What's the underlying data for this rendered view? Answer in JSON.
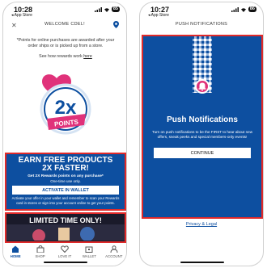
{
  "left_screen": {
    "status": {
      "time": "10:28",
      "back_app": "◂ App Store",
      "battery": "85"
    },
    "header": {
      "title": "WELCOME CDEL!"
    },
    "note": "*Points for online purchases are awarded after your order ships or is picked up from a store.",
    "rewards_link_prefix": "See how rewards work ",
    "rewards_link": "here",
    "points_text": "2x",
    "points_word": "POINTS",
    "promo": {
      "title_line1": "EARN FREE PRODUCTS",
      "title_line2": "2X FASTER!",
      "subtitle": "Get 2X Rewards points on any purchase*",
      "limit": "One-time use only.",
      "button": "ACTIVATE IN WALLET",
      "fine_print": "Activate your offer in your wallet and remember to scan your Rewards card in stores or sign into your account online to get your points."
    },
    "limited_banner": "LIMITED TIME ONLY!",
    "tabs": [
      "HOME",
      "SHOP",
      "LOVE IT",
      "WALLET",
      "ACCOUNT"
    ]
  },
  "right_screen": {
    "status": {
      "time": "10:27",
      "back_app": "◂ App Store",
      "battery": "86"
    },
    "header": {
      "title": "PUSH NOTIFICATIONS"
    },
    "title": "Push Notifications",
    "description": "Turn on push notifications to be the FIRST to hear about new offers, sneak peeks and special members-only events!",
    "button": "CONTINUE",
    "privacy_link": "Privacy & Legal"
  },
  "colors": {
    "brand_blue": "#0d4fa0",
    "highlight_red": "#e02a2a",
    "pink": "#e0327a"
  }
}
